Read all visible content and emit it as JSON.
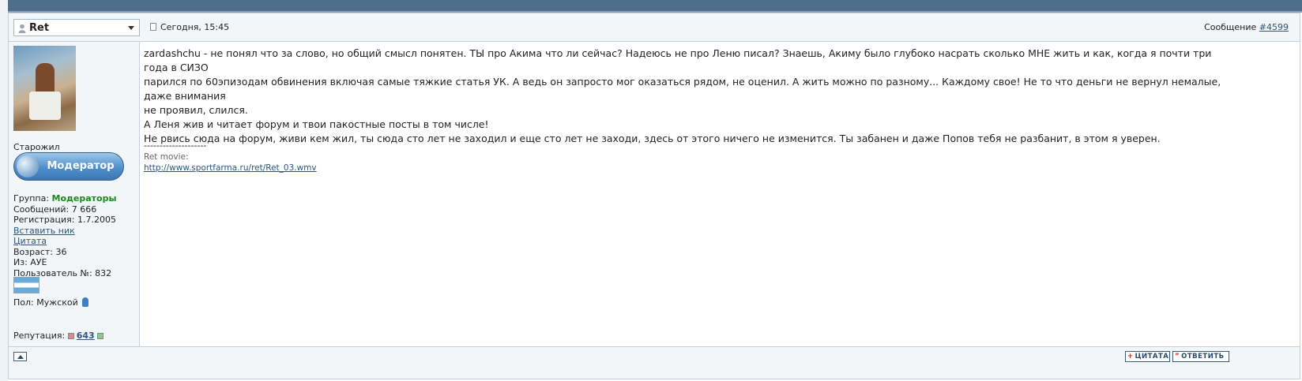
{
  "post": {
    "author": "Ret",
    "date": "Сегодня, 15:45",
    "message_label": "Сообщение ",
    "message_number": "#4599",
    "body": [
      "zardashchu - не понял что за слово, но общий смысл понятен. ТЫ про Акима что ли сейчас? Надеюсь не про Леню писал? Знаешь, Акиму было глубоко насрать сколько МНЕ жить и как, когда я почти три года в СИЗО",
      "парился по 60эпизодам обвинения включая самые тяжкие статья УК. А ведь он запросто мог оказаться рядом, не оценил. А жить можно по разному... Каждому свое! Не то что деньги не вернул немалые, даже внимания",
      "не проявил, слился.",
      "А Леня жив и читает форум и твои пакостные посты в том числе!",
      "Не рвись сюда на форум, живи кем жил, ты сюда сто лет не заходил и еще сто лет не заходи, здесь от этого ничего не изменится. Ты забанен и даже Попов тебя не разбанит, в этом я уверен."
    ],
    "signature": {
      "separator": "--------------------",
      "label": "Ret movie:",
      "link": "http://www.sportfarma.ru/ret/Ret_03.wmv"
    }
  },
  "profile": {
    "rank": "Старожил",
    "badge": "Модератор",
    "group_label": "Группа: ",
    "group_value": "Модераторы",
    "messages": "Сообщений: 7 666",
    "registered": "Регистрация: 1.7.2005",
    "insert_nick": "Вставить ник",
    "quote": "Цитата",
    "age": "Возраст: 36",
    "from": "Из: АУЕ",
    "user_no": "Пользователь №: 832",
    "gender": "Пол: Мужской",
    "reputation_label": "Репутация: ",
    "reputation_value": "643"
  },
  "footer": {
    "quote_btn": "ЦИТАТА",
    "reply_btn": "ОТВЕТИТЬ"
  },
  "icons": {
    "user": "user-icon",
    "doc": "document-icon",
    "up": "chevron-up-icon",
    "quote_plus": "plus-icon",
    "reply_quote": "quote-marks-icon"
  },
  "colors": {
    "top_bar": "#4f6e8c",
    "link": "#2a5680",
    "group_green": "#1a8a1a",
    "badge_blue": "#4f8fcb"
  }
}
